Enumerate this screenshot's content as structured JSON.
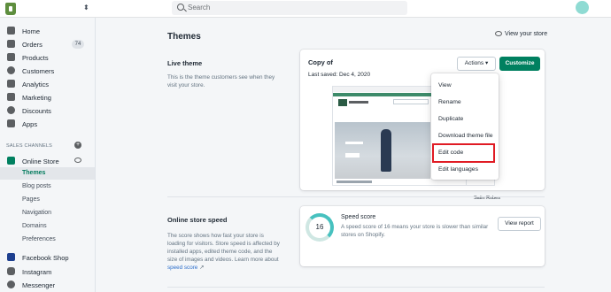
{
  "topbar": {
    "search_placeholder": "Search"
  },
  "sidebar": {
    "items": [
      {
        "label": "Home"
      },
      {
        "label": "Orders",
        "badge": "74"
      },
      {
        "label": "Products"
      },
      {
        "label": "Customers"
      },
      {
        "label": "Analytics"
      },
      {
        "label": "Marketing"
      },
      {
        "label": "Discounts"
      },
      {
        "label": "Apps"
      }
    ],
    "channels_label": "SALES CHANNELS",
    "online_store": "Online Store",
    "sub_items": [
      {
        "label": "Themes"
      },
      {
        "label": "Blog posts"
      },
      {
        "label": "Pages"
      },
      {
        "label": "Navigation"
      },
      {
        "label": "Domains"
      },
      {
        "label": "Preferences"
      }
    ],
    "bottom_items": [
      {
        "label": "Facebook Shop"
      },
      {
        "label": "Instagram"
      },
      {
        "label": "Messenger"
      }
    ]
  },
  "main": {
    "title": "Themes",
    "view_store": "View your store",
    "live_theme": {
      "heading": "Live theme",
      "description": "This is the theme customers see when they visit your store.",
      "theme_name": "Copy of",
      "saved": "Last saved: Dec 4, 2020",
      "actions_label": "Actions",
      "customize_label": "Customize",
      "preview_caption": "Satin Robes"
    },
    "actions_menu": [
      {
        "label": "View"
      },
      {
        "label": "Rename"
      },
      {
        "label": "Duplicate"
      },
      {
        "label": "Download theme file"
      },
      {
        "label": "Edit code"
      },
      {
        "label": "Edit languages"
      }
    ],
    "speed": {
      "heading": "Online store speed",
      "description": "The score shows how fast your store is loading for visitors. Store speed is affected by installed apps, edited theme code, and the size of images and videos. Learn more about",
      "link": "speed score",
      "score": "16",
      "score_title": "Speed score",
      "score_desc": "A speed score of 16 means your store is slower than similar stores on Shopify.",
      "report_label": "View report"
    }
  },
  "colors": {
    "accent": "#008060",
    "highlight": "#e01b24",
    "link": "#2c6ecb"
  }
}
